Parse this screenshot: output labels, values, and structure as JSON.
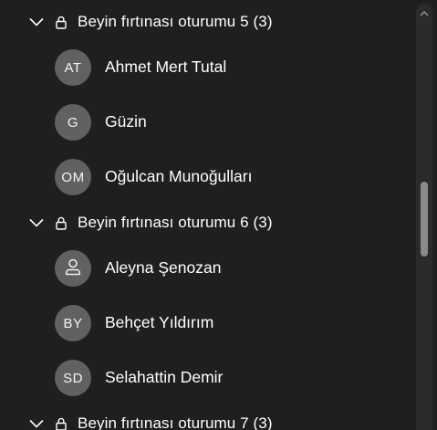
{
  "groups": [
    {
      "title": "Beyin fırtınası oturumu 5 (3)",
      "members": [
        {
          "initials": "AT",
          "name": "Ahmet Mert Tutal"
        },
        {
          "initials": "G",
          "name": "Güzin"
        },
        {
          "initials": "OM",
          "name": "Oğulcan Munoğulları"
        }
      ]
    },
    {
      "title": "Beyin fırtınası oturumu 6 (3)",
      "members": [
        {
          "initials": "",
          "icon": "person-icon",
          "name": "Aleyna Şenozan"
        },
        {
          "initials": "BY",
          "name": "Behçet Yıldırım"
        },
        {
          "initials": "SD",
          "name": "Selahattin Demir"
        }
      ]
    },
    {
      "title": "Beyin fırtınası oturumu 7 (3)",
      "members": []
    }
  ],
  "icons": {
    "group_toggle": "chevron-down-icon",
    "group_lock": "lock-icon",
    "scroll_up": "chevron-up-icon"
  },
  "colors": {
    "background": "#1f1f1f",
    "avatar": "#616161",
    "text": "#ffffff",
    "scroll_thumb": "#8a8a8a"
  }
}
